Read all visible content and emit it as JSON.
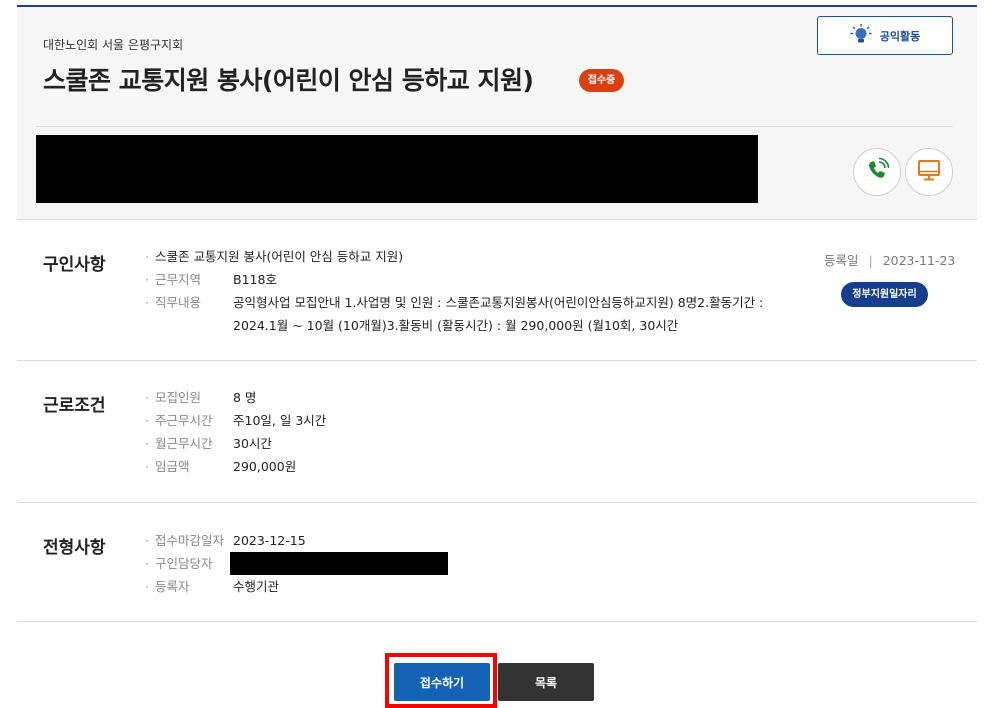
{
  "header": {
    "organization": "대한노인회 서울 은평구지회",
    "title": "스쿨존 교통지원 봉사(어린이 안심 등하교 지원)",
    "status_badge": "접수중",
    "activity_button": "공익활동",
    "icons": [
      "lightbulb-icon",
      "phone-icon",
      "monitor-icon"
    ],
    "colors": {
      "accent": "#1f4e9c",
      "status": "#d9400f",
      "apply": "#1462b3"
    }
  },
  "job_info": {
    "heading": "구인사항",
    "summary": "스쿨존 교통지원 봉사(어린이 안심 등하교 지원)",
    "location_label": "근무지역",
    "location_value": "B118호",
    "description_label": "직무내용",
    "description_line1": "공익형사업 모집안내  1.사업명 및 인원 : 스쿨존교통지원봉사(어린이안심등하교지원) 8명2.활동기간 :",
    "description_line2": "2024.1월 ~ 10월 (10개월)3.활동비 (활동시간) : 월 290,000원 (월10회, 30시간",
    "registered_label": "등록일",
    "registered_date": "2023-11-23",
    "job_type_badge": "정부지원일자리"
  },
  "conditions": {
    "heading": "근로조건",
    "rows": [
      {
        "label": "모집인원",
        "value": "8 명"
      },
      {
        "label": "주근무시간",
        "value": "주10일, 일 3시간"
      },
      {
        "label": "월근무시간",
        "value": "30시간"
      },
      {
        "label": "임금액",
        "value": "290,000원"
      }
    ]
  },
  "selection": {
    "heading": "전형사항",
    "deadline_label": "접수마감일자",
    "deadline_value": "2023-12-15",
    "contact_label": "구인담당자",
    "registrant_label": "등록자",
    "registrant_value": "수행기관"
  },
  "actions": {
    "apply": "접수하기",
    "list": "목록"
  }
}
